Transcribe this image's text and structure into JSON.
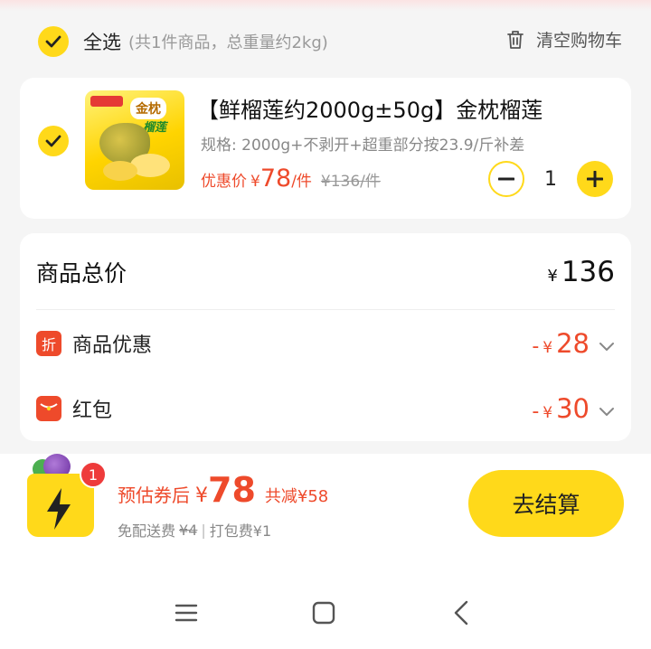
{
  "select_bar": {
    "select_all_label": "全选",
    "select_meta": "(共1件商品，总重量约2kg)",
    "clear_cart_label": "清空购物车",
    "icons": {
      "check": "check-icon",
      "trash": "trash-icon"
    }
  },
  "product": {
    "image_text_1": "金枕",
    "image_text_2": "榴莲",
    "title": "【鲜榴莲约2000g±50g】金枕榴莲",
    "spec": "规格: 2000g+不剥开+超重部分按23.9/斤补差",
    "promo_label": "优惠价",
    "currency": "¥",
    "promo_price": "78",
    "unit": "/件",
    "original_price": "¥136/件",
    "quantity": "1"
  },
  "summary": {
    "total_label": "商品总价",
    "total_currency": "¥",
    "total_value": "136",
    "discount_icon_text": "折",
    "discount_label": "商品优惠",
    "discount_value": "28",
    "redpacket_label": "红包",
    "redpacket_value": "30",
    "minus_sign": "-",
    "currency": "¥"
  },
  "footer": {
    "badge_count": "1",
    "estimate_label": "预估券后",
    "currency": "¥",
    "estimate_price": "78",
    "save_text": "共减¥58",
    "delivery_label": "免配送费",
    "delivery_original": "¥4",
    "separator": "|",
    "packing_fee": "打包费¥1",
    "checkout_label": "去结算"
  },
  "colors": {
    "accent_yellow": "#ffd91a",
    "price_red": "#ee4a2b",
    "badge_red": "#ee3b3b"
  },
  "nav": {
    "icons": [
      "menu-icon",
      "home-square-icon",
      "back-icon"
    ]
  }
}
